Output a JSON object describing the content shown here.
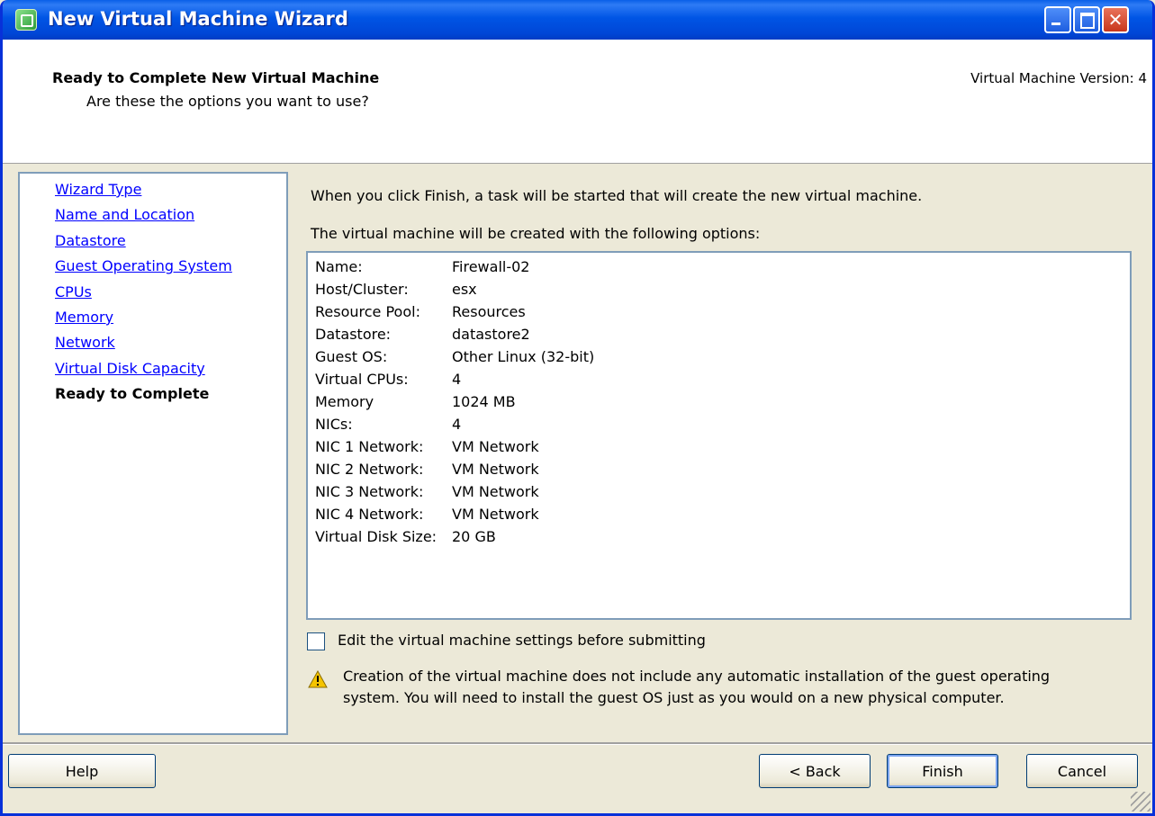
{
  "window": {
    "title": "New Virtual Machine Wizard",
    "icon": "vm-wizard-icon",
    "controls": [
      "minimize-icon",
      "maximize-icon",
      "close-icon"
    ]
  },
  "header": {
    "title": "Ready to Complete New Virtual Machine",
    "subtitle": "Are these the options you want to use?",
    "version": "Virtual Machine Version: 4"
  },
  "nav": {
    "items": [
      {
        "label": "Wizard Type"
      },
      {
        "label": "Name and Location"
      },
      {
        "label": "Datastore"
      },
      {
        "label": "Guest Operating System"
      },
      {
        "label": "CPUs"
      },
      {
        "label": "Memory"
      },
      {
        "label": "Network"
      },
      {
        "label": "Virtual Disk Capacity"
      },
      {
        "label": "Ready to Complete"
      }
    ],
    "current": "Ready to Complete"
  },
  "main": {
    "intro1": "When you click Finish, a task will be started that will create the new virtual machine.",
    "intro2": "The virtual machine will be created with the following options:",
    "summary": [
      {
        "key": "Name:",
        "value": "Firewall-02"
      },
      {
        "key": "Host/Cluster:",
        "value": "esx"
      },
      {
        "key": "Resource Pool:",
        "value": "Resources"
      },
      {
        "key": "Datastore:",
        "value": "datastore2"
      },
      {
        "key": "Guest OS:",
        "value": "Other Linux (32-bit)"
      },
      {
        "key": "Virtual CPUs:",
        "value": "4"
      },
      {
        "key": "Memory",
        "value": "1024 MB"
      },
      {
        "key": "NICs:",
        "value": "4"
      },
      {
        "key": "NIC 1 Network:",
        "value": "VM Network"
      },
      {
        "key": "NIC 2 Network:",
        "value": "VM Network"
      },
      {
        "key": "NIC 3 Network:",
        "value": "VM Network"
      },
      {
        "key": "NIC 4 Network:",
        "value": "VM Network"
      },
      {
        "key": "Virtual Disk Size:",
        "value": "20 GB"
      }
    ],
    "edit_settings_label": "Edit the virtual machine settings before submitting",
    "edit_settings_checked": false,
    "warning_line1": "Creation of the virtual machine does not include any automatic installation of the guest operating",
    "warning_line2": "system. You will need to install the guest OS just as you would on a new physical computer.",
    "warning_icon": "warning-icon"
  },
  "buttons": {
    "help": "Help",
    "back": "< Back",
    "finish": "Finish",
    "cancel": "Cancel"
  },
  "colors": {
    "titlebar": "#0055e5",
    "link": "#0000ff",
    "window_bg": "#ece9d8"
  }
}
